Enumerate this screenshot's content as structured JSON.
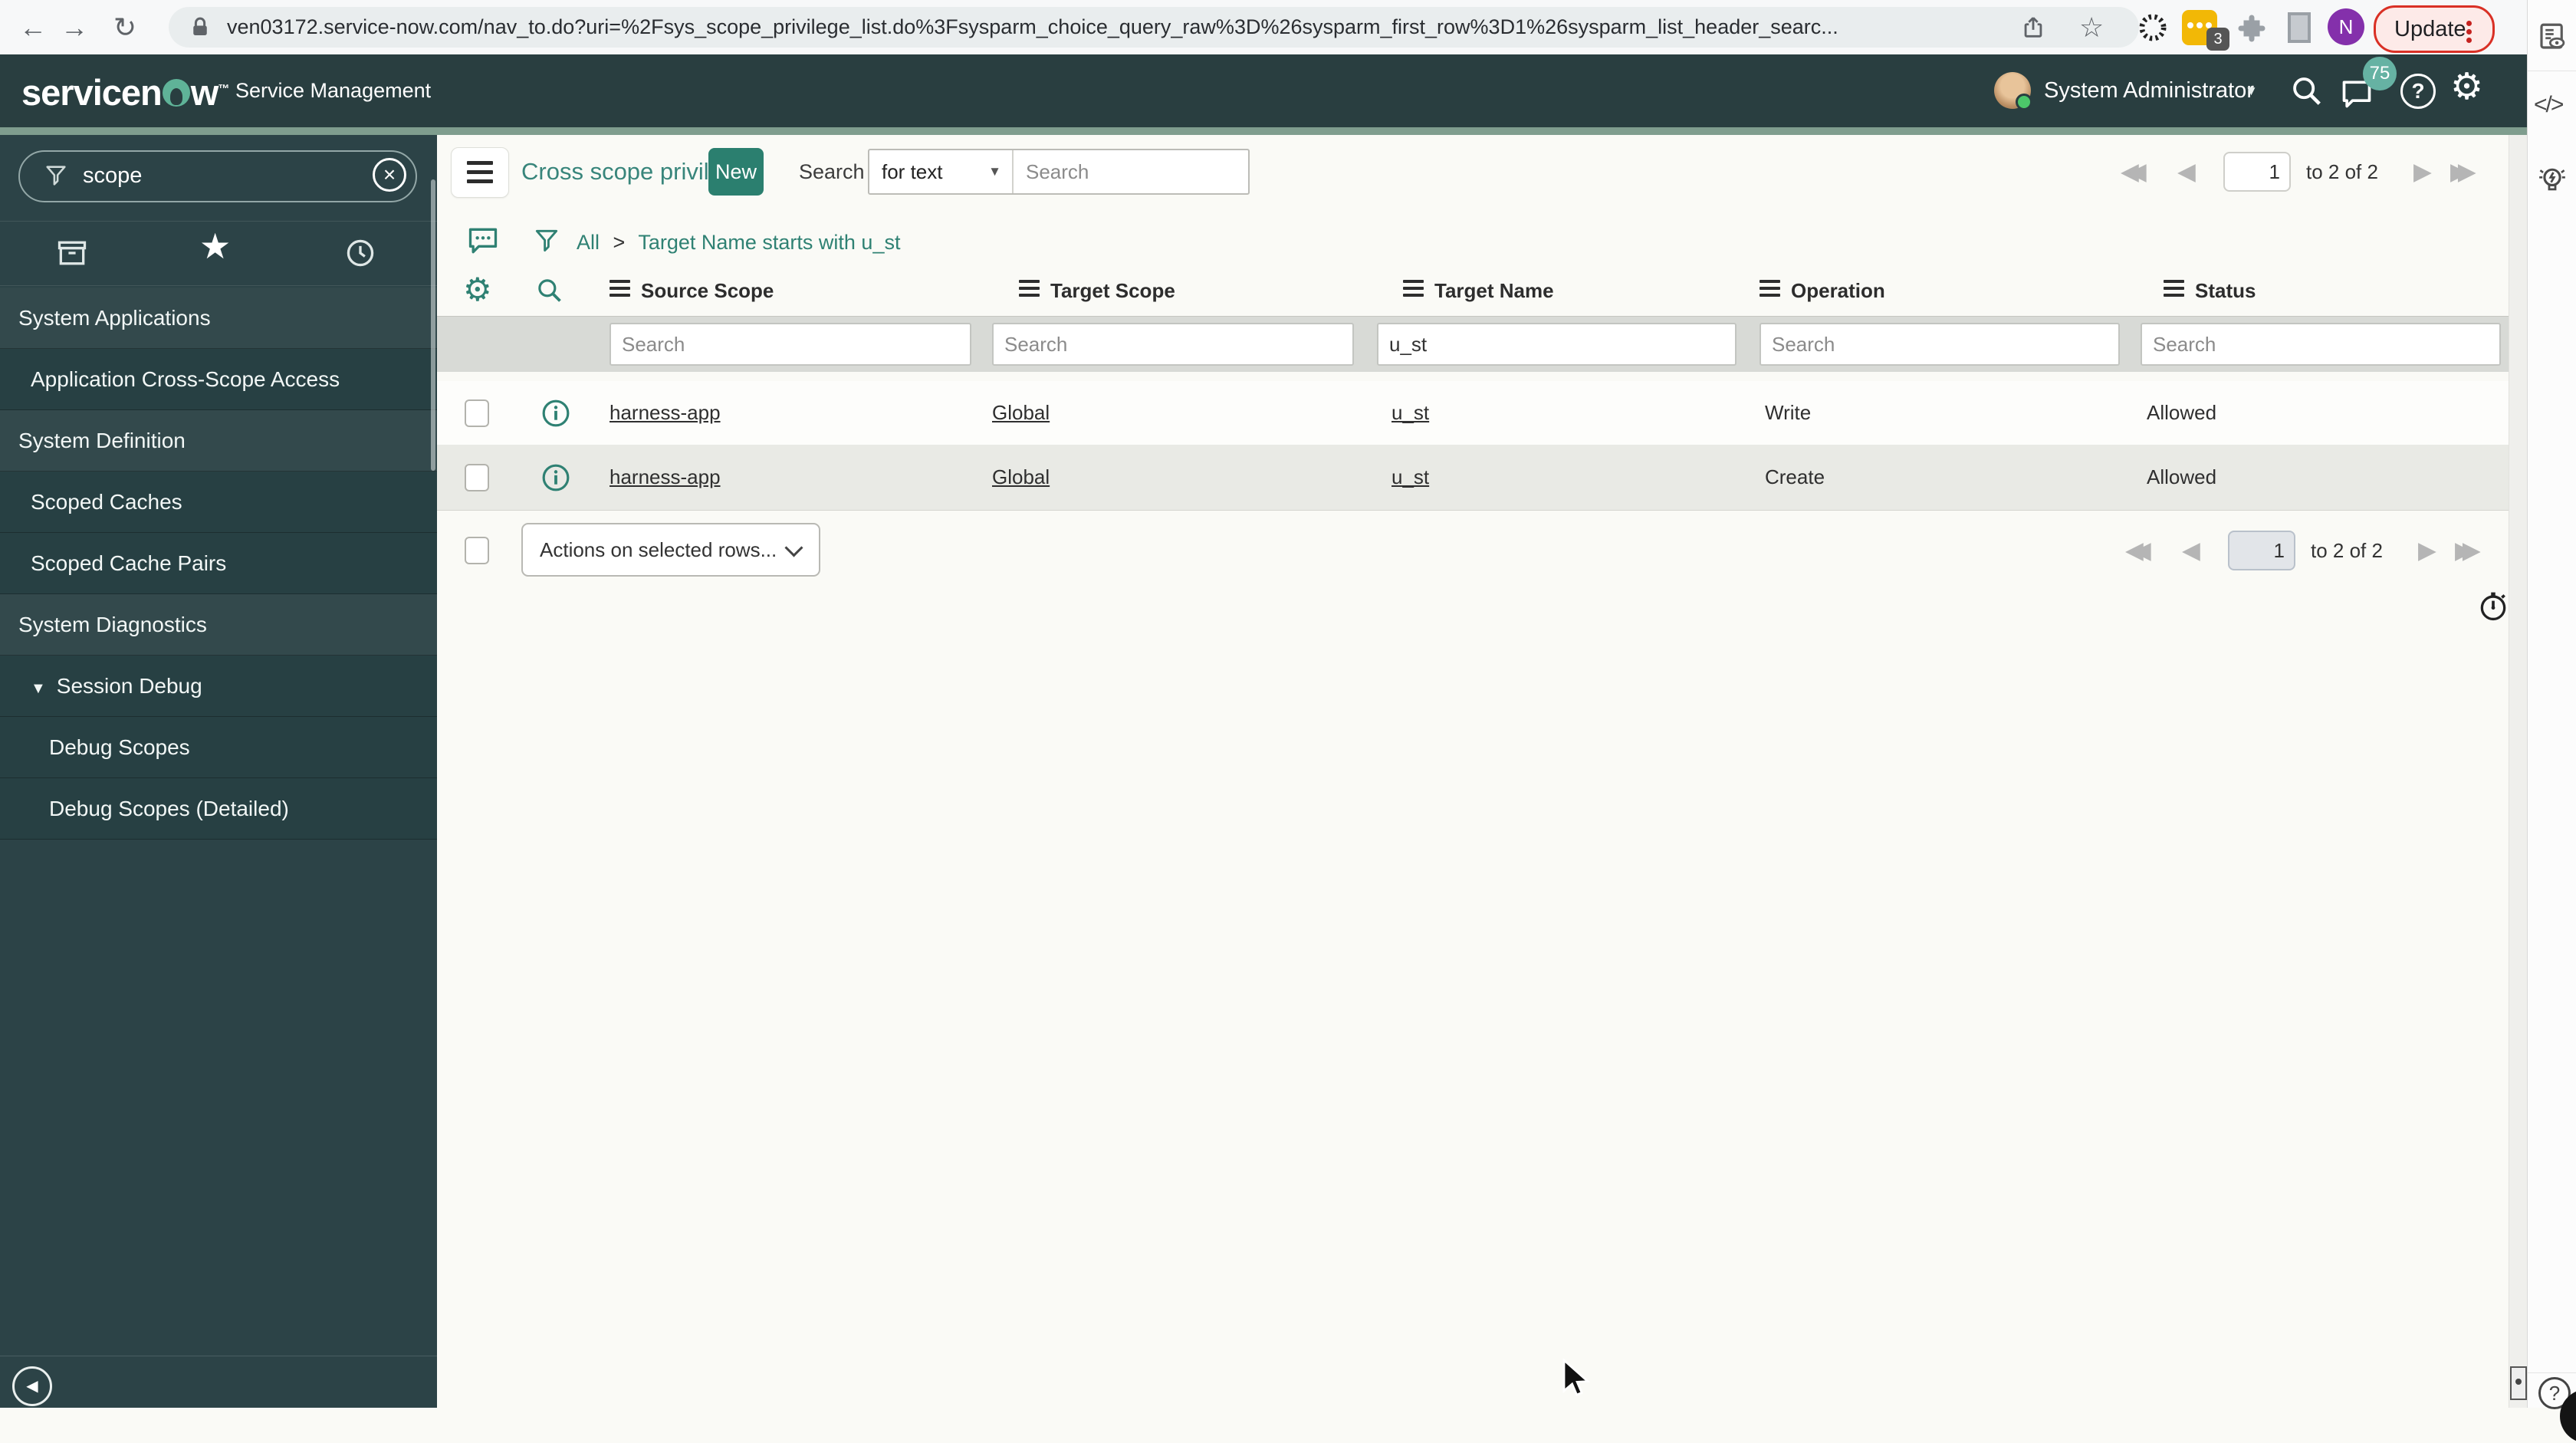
{
  "browser": {
    "url": "ven03172.service-now.com/nav_to.do?uri=%2Fsys_scope_privilege_list.do%3Fsysparm_choice_query_raw%3D%26sysparm_first_row%3D1%26sysparm_list_header_searc...",
    "update_label": "Update",
    "profile_initial": "N",
    "extension_badge": "3"
  },
  "right_panel": {
    "code_label": "</>"
  },
  "app_header": {
    "logo_left": "servicen",
    "logo_right": "w",
    "tm": "™",
    "product": "Service Management",
    "user_name": "System Administrator",
    "notification_count": "75"
  },
  "sidebar": {
    "search_value": "scope",
    "items": [
      {
        "label": "System Applications"
      },
      {
        "label": "Application Cross-Scope Access"
      },
      {
        "label": "System Definition"
      },
      {
        "label": "Scoped Caches"
      },
      {
        "label": "Scoped Cache Pairs"
      },
      {
        "label": "System Diagnostics"
      },
      {
        "label": "Session Debug"
      },
      {
        "label": "Debug Scopes"
      },
      {
        "label": "Debug Scopes (Detailed)"
      }
    ]
  },
  "list": {
    "title": "Cross scope privileges",
    "new_button": "New",
    "search_label": "Search",
    "search_type": "for text",
    "search_placeholder": "Search",
    "breadcrumb": {
      "root": "All",
      "separator": ">",
      "condition": "Target Name starts with u_st"
    },
    "columns": [
      {
        "label": "Source Scope"
      },
      {
        "label": "Target Scope"
      },
      {
        "label": "Target Name"
      },
      {
        "label": "Operation"
      },
      {
        "label": "Status"
      }
    ],
    "filter_row": {
      "placeholder": "Search",
      "target_name_value": "u_st"
    },
    "rows": [
      {
        "source_scope": "harness-app",
        "target_scope": "Global",
        "target_name": "u_st",
        "operation": "Write",
        "status": "Allowed"
      },
      {
        "source_scope": "harness-app",
        "target_scope": "Global",
        "target_name": "u_st",
        "operation": "Create",
        "status": "Allowed"
      }
    ],
    "actions_select": "Actions on selected rows...",
    "pagination": {
      "page": "1",
      "range_label": "to 2 of 2"
    }
  }
}
